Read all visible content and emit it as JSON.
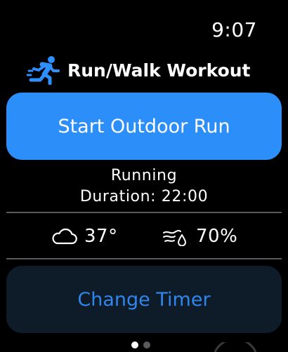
{
  "status_bar": {
    "time": "9:07"
  },
  "header": {
    "icon": "figure-run-icon",
    "title": "Run/Walk Workout"
  },
  "primary_action": {
    "label": "Start Outdoor Run"
  },
  "workout_info": {
    "mode": "Running",
    "duration": "Duration: 22:00"
  },
  "weather": {
    "temperature": {
      "icon": "cloud-icon",
      "value": "37°"
    },
    "humidity": {
      "icon": "humidity-icon",
      "value": "70%"
    }
  },
  "secondary_action": {
    "label": "Change Timer"
  },
  "pager": {
    "pages": 2,
    "current": 1
  },
  "colors": {
    "accent": "#2e8fff",
    "primary_button_bg": "#2c8ef8",
    "secondary_button_bg": "#0e1b28",
    "secondary_button_text": "#2f86ec",
    "divider": "#5a5a5e",
    "dot_active": "#ffffff",
    "dot_inactive": "#5a5a5e"
  }
}
